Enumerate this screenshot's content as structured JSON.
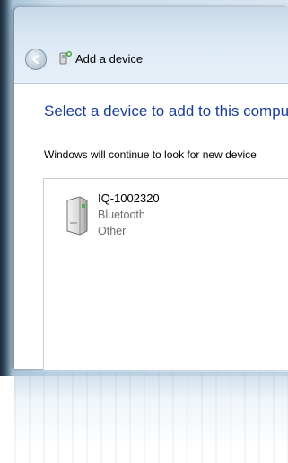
{
  "window": {
    "title": "Add a device",
    "icons": {
      "back": "back-arrow-icon",
      "title": "add-device-icon"
    }
  },
  "main": {
    "heading": "Select a device to add to this compu",
    "subtext": "Windows will continue to look for new device"
  },
  "devices": [
    {
      "name": "IQ-1002320",
      "type": "Bluetooth",
      "category": "Other",
      "icon": "computer-tower-icon"
    }
  ],
  "colors": {
    "heading": "#1a3e9c",
    "secondary_text": "#6d6d6d"
  }
}
